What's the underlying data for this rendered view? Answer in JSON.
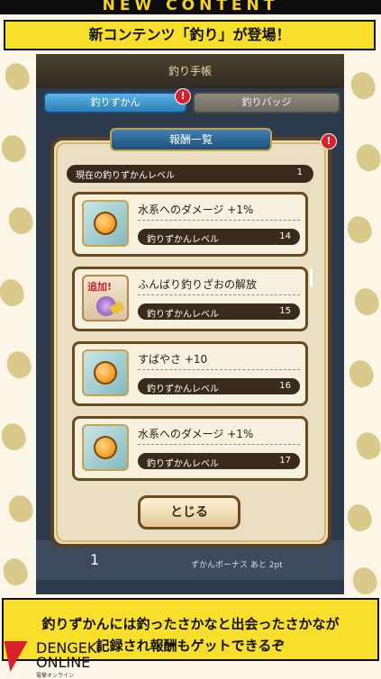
{
  "banner": {
    "top_label": "NEW CONTENT",
    "headline": "新コンテンツ「釣り」が登場！"
  },
  "game": {
    "book_title": "釣り手帳",
    "tabs": [
      {
        "label": "釣りずかん",
        "active": true
      },
      {
        "label": "釣りバッジ",
        "active": false
      }
    ],
    "alert_mark": "!",
    "background_page": "1",
    "background_bonus": "ずかんボーナス あと 2pt"
  },
  "dialog": {
    "title": "報酬一覧",
    "current_level_label": "現在の釣りずかんレベル",
    "current_level_value": "1",
    "rows": [
      {
        "text": "水系へのダメージ +1%",
        "level_label": "釣りずかんレベル",
        "level": "14",
        "icon": "orange-orb-icon"
      },
      {
        "text": "ふんばり釣りざおの解放",
        "level_label": "釣りずかんレベル",
        "level": "15",
        "icon": "add-item-icon",
        "icon_badge": "追加!"
      },
      {
        "text": "すばやさ +10",
        "level_label": "釣りずかんレベル",
        "level": "16",
        "icon": "orange-orb-icon"
      },
      {
        "text": "水系へのダメージ +1%",
        "level_label": "釣りずかんレベル",
        "level": "17",
        "icon": "orange-orb-icon"
      }
    ],
    "close_label": "とじる"
  },
  "caption": {
    "line1": "釣りずかんには釣ったさかなと出会ったさかなが",
    "line2": "記録され報酬もゲットできるぞ"
  },
  "logo": {
    "text": "DENGEKI ONLINE",
    "sub": "電撃オンライン"
  },
  "colors": {
    "accent_yellow": "#f7df2c",
    "dialog_bg": "#eadfc2",
    "frame_brown": "#6b4a1e",
    "alert_red": "#d8212b"
  }
}
